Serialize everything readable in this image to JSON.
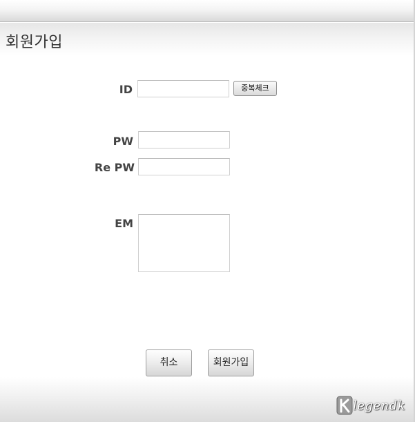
{
  "header": {
    "title": "회원가입"
  },
  "form": {
    "id_label": "ID",
    "id_value": "",
    "duplicate_check_label": "중복체크",
    "pw_label": "PW",
    "pw_value": "",
    "repw_label": "Re PW",
    "repw_value": "",
    "em_label": "EM",
    "em_value": ""
  },
  "actions": {
    "cancel_label": "취소",
    "signup_label": "회원가입"
  },
  "watermark": {
    "text": "legendk",
    "icon": "k-logo-icon"
  }
}
